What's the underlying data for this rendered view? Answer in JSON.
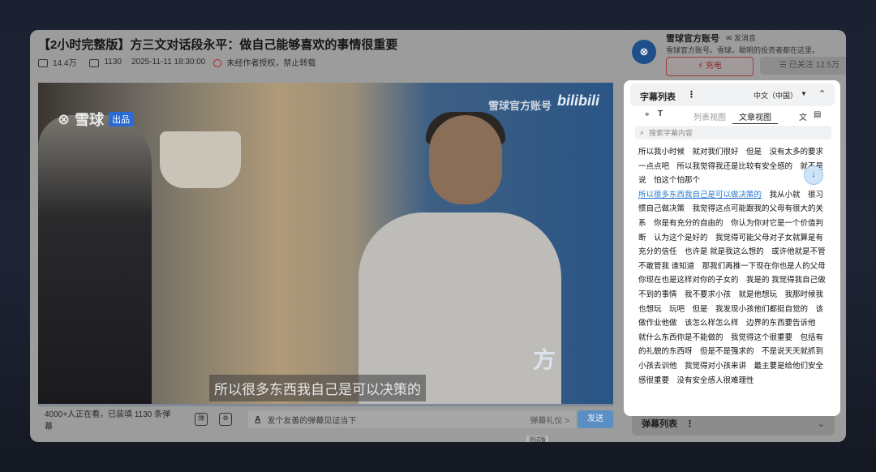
{
  "video": {
    "title": "【2小时完整版】方三文对话段永平：做自己能够喜欢的事情很重要",
    "views": "14.4万",
    "comments": "1130",
    "date": "2025-11-11 18:30:00",
    "notice": "未经作者授权，禁止转载",
    "logo_text": "雪球",
    "logo_tag": "出品",
    "watermark": "雪球官方账号",
    "bilibili": "bilibili",
    "subtitle_overlay": "所以很多东西我自己是可以决策的",
    "watermark_fang": "方"
  },
  "bar": {
    "viewers": "4000+人正在看，已装填 1130 条弹幕",
    "danmaku_a": "A",
    "danmaku_placeholder": "发个友善的弹幕见证当下",
    "etiquette": "弹幕礼仪 >",
    "send": "发送"
  },
  "account": {
    "name": "雪球官方账号",
    "message": "发消息",
    "desc": "雪球官方账号。雪球，聪明的投资者都在这里。",
    "charge": "充电",
    "follow": "已关注 12.5万"
  },
  "subtitle_panel": {
    "title": "字幕列表",
    "language": "中文（中国）",
    "tab_list": "列表视图",
    "tab_article": "文章视图",
    "search_placeholder": "搜索字幕内容",
    "lines_pre": "所以我小时候　就对我们很好　但是　没有太多的要求　一点点吧　所以我觉得我还是比较有安全感的　就不是说　怕这个怕那个",
    "highlight": "所以很多东西我自己是可以做决策的",
    "lines_post": "　我从小就　很习惯自己做决策　我觉得这点可能跟我的父母有很大的关系　你是有充分的自由的　你认为你对它是一个价值判断　认为这个是好的　我觉得可能父母对子女就算是有充分的信任　也许是 就是我这么想的　或许他就是不管　不敢管我 谁知道　那我们再推一下现在你也是人的父母　你现在也是这样对你的子女的　我是的 我觉得我自己做不到的事情　我不要求小孩　就是他想玩　我那时候我也想玩　玩吧　但是　我发现小孩他们都挺自觉的　该做作业他做　该怎么样怎么样　边界的东西要告诉他　就什么东西你是不能做的　我觉得这个很重要　包括有的礼貌的东西呀　但是不是强求的　不是说天天就抓到小孩去训他　我觉得对小孩来讲　最主要是给他们安全感很重要　没有安全感人很难理性"
  },
  "danmaku_list": {
    "title": "弹幕列表"
  },
  "test_tag": "测试版"
}
